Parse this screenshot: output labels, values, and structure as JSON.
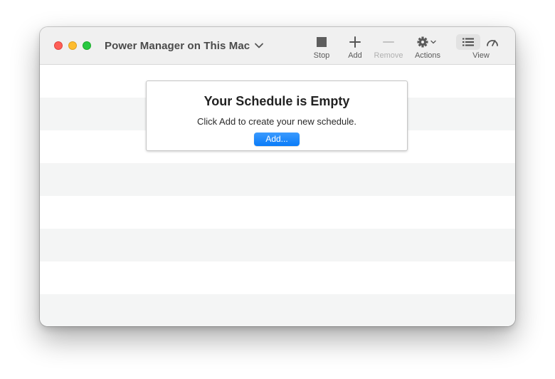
{
  "window": {
    "title": "Power Manager on This Mac",
    "traffic_lights": [
      "close",
      "minimize",
      "zoom"
    ]
  },
  "toolbar": {
    "stop_label": "Stop",
    "add_label": "Add",
    "remove_label": "Remove",
    "actions_label": "Actions",
    "view_label": "View",
    "remove_disabled": true,
    "view_selected": "list"
  },
  "empty_state": {
    "title": "Your Schedule is Empty",
    "description": "Click Add to create your new schedule.",
    "button_label": "Add..."
  },
  "colors": {
    "accent": "#0a7cf8",
    "row_alt": "#f4f5f5",
    "titlebar": "#f0f0f0"
  }
}
